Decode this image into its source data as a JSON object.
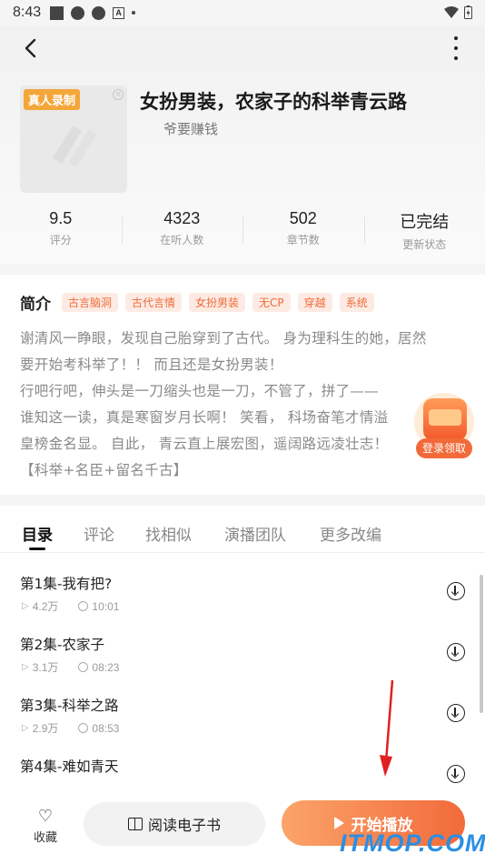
{
  "status_bar": {
    "time": "8:43"
  },
  "book": {
    "badge": "真人录制",
    "title": "女扮男装，农家子的科举青云路",
    "author": "爷要赚钱"
  },
  "stats": [
    {
      "value": "9.5",
      "label": "评分"
    },
    {
      "value": "4323",
      "label": "在听人数"
    },
    {
      "value": "502",
      "label": "章节数"
    },
    {
      "value": "已完结",
      "label": "更新状态"
    }
  ],
  "intro": {
    "heading": "简介",
    "tags": [
      "古言脑洞",
      "古代言情",
      "女扮男装",
      "无CP",
      "穿越",
      "系统"
    ],
    "lines": [
      "谢清风一睁眼，发现自己胎穿到了古代。 身为理科生的她，居然",
      "要开始考科举了！！ 而且还是女扮男装！",
      "行吧行吧，伸头是一刀缩头也是一刀，不管了，拼了——",
      "谁知这一读，真是寒窗岁月长啊！ 笑看， 科场奋笔才情溢",
      "皇榜金名显。 自此， 青云直上展宏图，遥阔路远凌壮志！",
      "【科举+名臣+留名千古】"
    ]
  },
  "promo": {
    "label": "登录领取"
  },
  "tabs": [
    "目录",
    "评论",
    "找相似",
    "演播团队",
    "更多改编"
  ],
  "episodes": [
    {
      "name": "第1集-我有把?",
      "plays": "4.2万",
      "duration": "10:01"
    },
    {
      "name": "第2集-农家子",
      "plays": "3.1万",
      "duration": "08:23"
    },
    {
      "name": "第3集-科举之路",
      "plays": "2.9万",
      "duration": "08:53"
    },
    {
      "name": "第4集-难如青天",
      "plays": "",
      "duration": ""
    }
  ],
  "bottom_bar": {
    "favorite_label": "收藏",
    "read_label": "阅读电子书",
    "play_label": "开始播放"
  },
  "watermark": "ITMOP.COM",
  "colors": {
    "accent": "#f26a3a",
    "tag_bg": "#fdebe3",
    "badge": "#f4a63a",
    "watermark": "#2b8fe3"
  }
}
